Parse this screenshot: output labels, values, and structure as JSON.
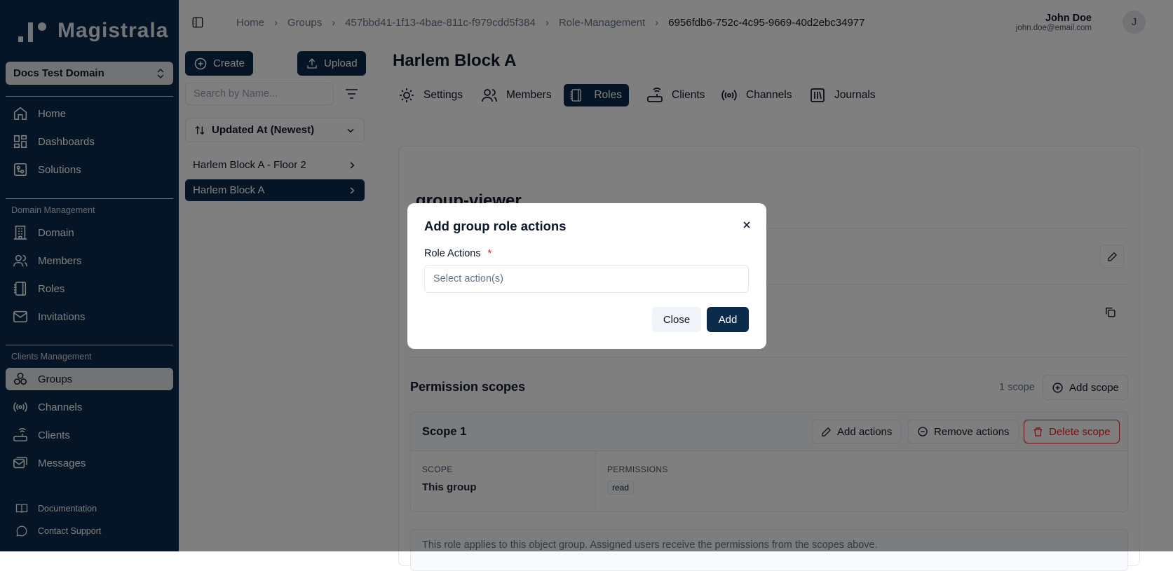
{
  "brand": {
    "name": "Magistrala"
  },
  "sidebar": {
    "domain": "Docs Test Domain",
    "main_items": [
      {
        "label": "Home",
        "icon": "home-icon"
      },
      {
        "label": "Dashboards",
        "icon": "dashboard-icon"
      },
      {
        "label": "Solutions",
        "icon": "solutions-icon"
      }
    ],
    "domain_section": "Domain Management",
    "domain_items": [
      {
        "label": "Domain",
        "icon": "building-icon"
      },
      {
        "label": "Members",
        "icon": "users-icon"
      },
      {
        "label": "Roles",
        "icon": "notebook-icon"
      },
      {
        "label": "Invitations",
        "icon": "mail-icon"
      }
    ],
    "clients_section": "Clients Management",
    "clients_items": [
      {
        "label": "Groups",
        "icon": "groups-icon",
        "active": true
      },
      {
        "label": "Channels",
        "icon": "radio-icon"
      },
      {
        "label": "Clients",
        "icon": "router-icon"
      },
      {
        "label": "Messages",
        "icon": "messages-icon"
      }
    ],
    "footer": [
      {
        "label": "Documentation",
        "icon": "book-icon"
      },
      {
        "label": "Contact Support",
        "icon": "chat-icon"
      }
    ]
  },
  "breadcrumb": [
    "Home",
    "Groups",
    "457bbd41-1f13-4bae-811c-f979cdd5f384",
    "Role-Management",
    "6956fdb6-752c-4c95-9669-40d2ebc34977"
  ],
  "user": {
    "name": "John Doe",
    "email": "john.doe@email.com",
    "initial": "J"
  },
  "left_panel": {
    "create_label": "Create",
    "upload_label": "Upload",
    "search_placeholder": "Search by Name...",
    "sort_label": "Updated At (Newest)",
    "groups": [
      {
        "label": "Harlem Block A - Floor 2",
        "active": false
      },
      {
        "label": "Harlem Block A",
        "active": true
      }
    ]
  },
  "main": {
    "title": "Harlem Block A",
    "tabs": [
      {
        "label": "Settings",
        "icon": "gear-icon"
      },
      {
        "label": "Members",
        "icon": "users-icon"
      },
      {
        "label": "Roles",
        "icon": "notebook-icon",
        "active": true
      },
      {
        "label": "Clients",
        "icon": "router-icon"
      },
      {
        "label": "Channels",
        "icon": "radio-icon"
      },
      {
        "label": "Journals",
        "icon": "library-icon"
      }
    ],
    "role_name": "group-viewer",
    "permission_scopes_title": "Permission scopes",
    "scope_count": "1 scope",
    "add_scope_label": "Add scope",
    "scope": {
      "name": "Scope 1",
      "add_actions": "Add actions",
      "remove_actions": "Remove actions",
      "delete_scope": "Delete scope",
      "scope_header": "SCOPE",
      "scope_value": "This group",
      "permissions_header": "PERMISSIONS",
      "permissions": [
        "read"
      ]
    },
    "note": "This role applies to this object group. Assigned users receive the permissions from the scopes above."
  },
  "modal": {
    "title": "Add group role actions",
    "field_label": "Role Actions",
    "required_mark": "*",
    "placeholder": "Select action(s)",
    "close_label": "Close",
    "add_label": "Add"
  },
  "colors": {
    "primary": "#0c2b4b",
    "danger": "#dc2626",
    "overlay": "rgba(0,0,0,0.5)"
  }
}
